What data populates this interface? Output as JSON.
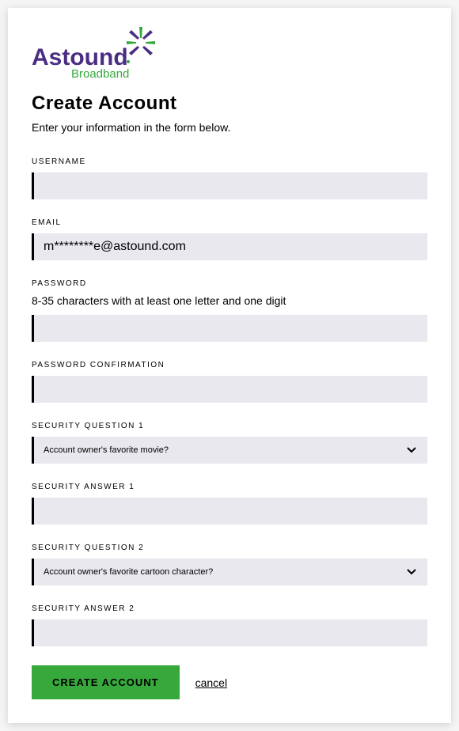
{
  "logo": {
    "brand": "Astound",
    "sub": "Broadband"
  },
  "header": {
    "title": "Create Account",
    "subtitle": "Enter your information in the form below."
  },
  "fields": {
    "username": {
      "label": "USERNAME",
      "value": ""
    },
    "email": {
      "label": "EMAIL",
      "value": "m********e@astound.com"
    },
    "password": {
      "label": "PASSWORD",
      "hint": "8-35 characters with at least one letter and one digit",
      "value": ""
    },
    "password_confirm": {
      "label": "PASSWORD CONFIRMATION",
      "value": ""
    },
    "sq1": {
      "label": "SECURITY QUESTION 1",
      "selected": "Account owner's favorite movie?"
    },
    "sa1": {
      "label": "SECURITY ANSWER 1",
      "value": ""
    },
    "sq2": {
      "label": "SECURITY QUESTION 2",
      "selected": "Account owner's favorite cartoon character?"
    },
    "sa2": {
      "label": "SECURITY ANSWER 2",
      "value": ""
    }
  },
  "actions": {
    "submit_label": "CREATE ACCOUNT",
    "cancel_label": "cancel"
  }
}
